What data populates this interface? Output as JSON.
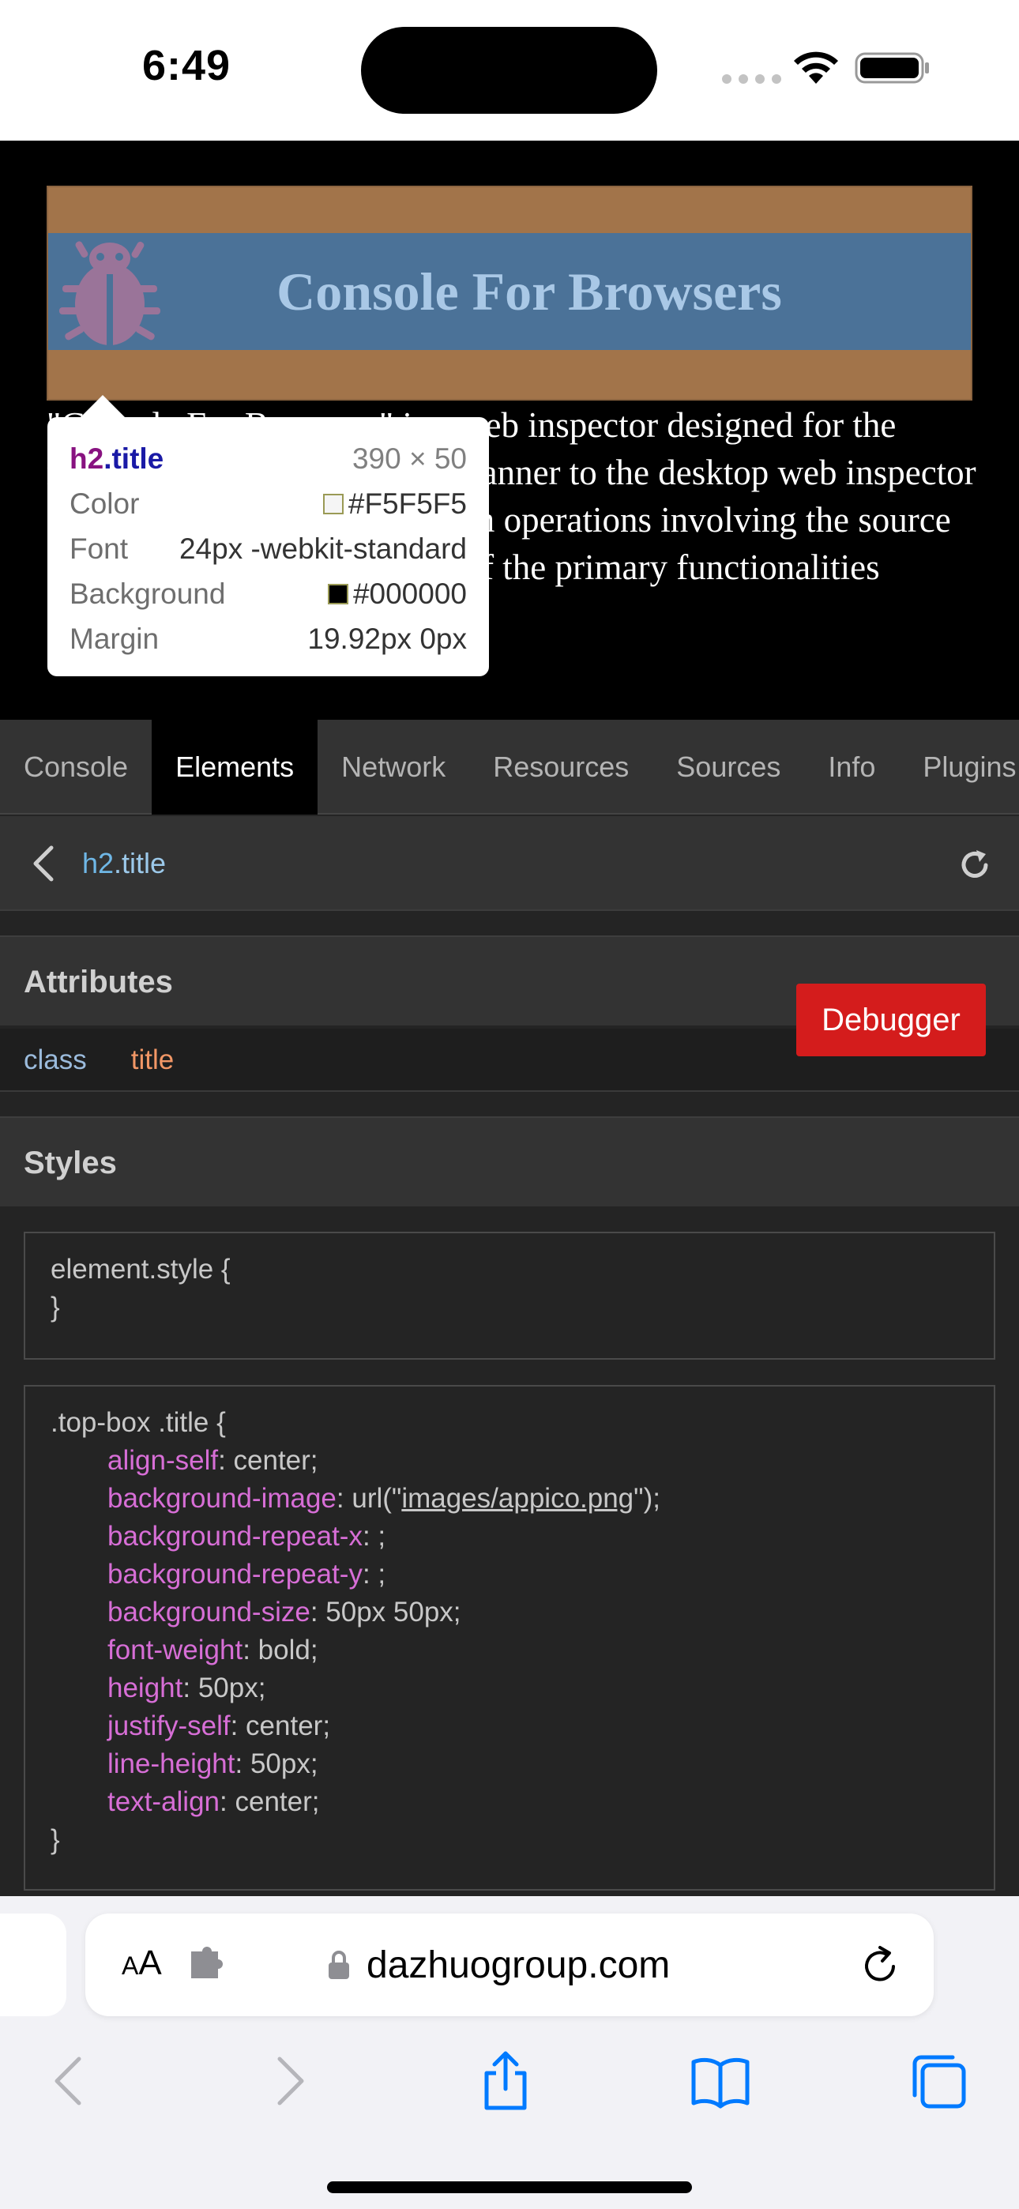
{
  "status_bar": {
    "time": "6:49"
  },
  "webpage": {
    "banner_title": "Console For Browsers",
    "body_text": "\"Console For Browsers\" is a web inspector designed for the mobile browser, in a similar manner to the desktop web inspector and empowers users to perform operations involving the source code of web pages. A review of the primary functionalities appear to you below."
  },
  "tooltip": {
    "tag": "h2",
    "class": ".title",
    "size": "390 × 50",
    "rows": [
      {
        "label": "Color",
        "value": "#F5F5F5",
        "swatch": "#F5F5F5"
      },
      {
        "label": "Font",
        "value": "24px -webkit-standard"
      },
      {
        "label": "Background",
        "value": "#000000",
        "swatch": "#000000"
      },
      {
        "label": "Margin",
        "value": "19.92px 0px"
      }
    ]
  },
  "devtools": {
    "tabs": [
      "Console",
      "Elements",
      "Network",
      "Resources",
      "Sources",
      "Info",
      "Plugins"
    ],
    "active_tab": "Elements",
    "breadcrumb": {
      "tag": "h2",
      "class": ".title"
    },
    "attributes_header": "Attributes",
    "attribute": {
      "name": "class",
      "value": "title"
    },
    "styles_header": "Styles",
    "element_style": {
      "open": "element.style {",
      "close": "}"
    },
    "rule": {
      "selector": ".top-box .title {",
      "close": "}",
      "declarations": [
        {
          "prop": "align-self",
          "value": "center;"
        },
        {
          "prop": "background-image",
          "value": "url(\"",
          "link": "images/appico.png",
          "suffix": "\");"
        },
        {
          "prop": "background-repeat-x",
          "value": ";"
        },
        {
          "prop": "background-repeat-y",
          "value": ";"
        },
        {
          "prop": "background-size",
          "value": "50px 50px;"
        },
        {
          "prop": "font-weight",
          "value": "bold;"
        },
        {
          "prop": "height",
          "value": "50px;"
        },
        {
          "prop": "justify-self",
          "value": "center;"
        },
        {
          "prop": "line-height",
          "value": "50px;"
        },
        {
          "prop": "text-align",
          "value": "center;"
        }
      ]
    },
    "debugger_button": "Debugger"
  },
  "safari": {
    "aa": {
      "small": "A",
      "large": "A"
    },
    "domain": "dazhuogroup.com"
  },
  "colors": {
    "accent_red": "#d41c1c",
    "css_property": "#d76ed6",
    "link_blue": "#007aff"
  }
}
